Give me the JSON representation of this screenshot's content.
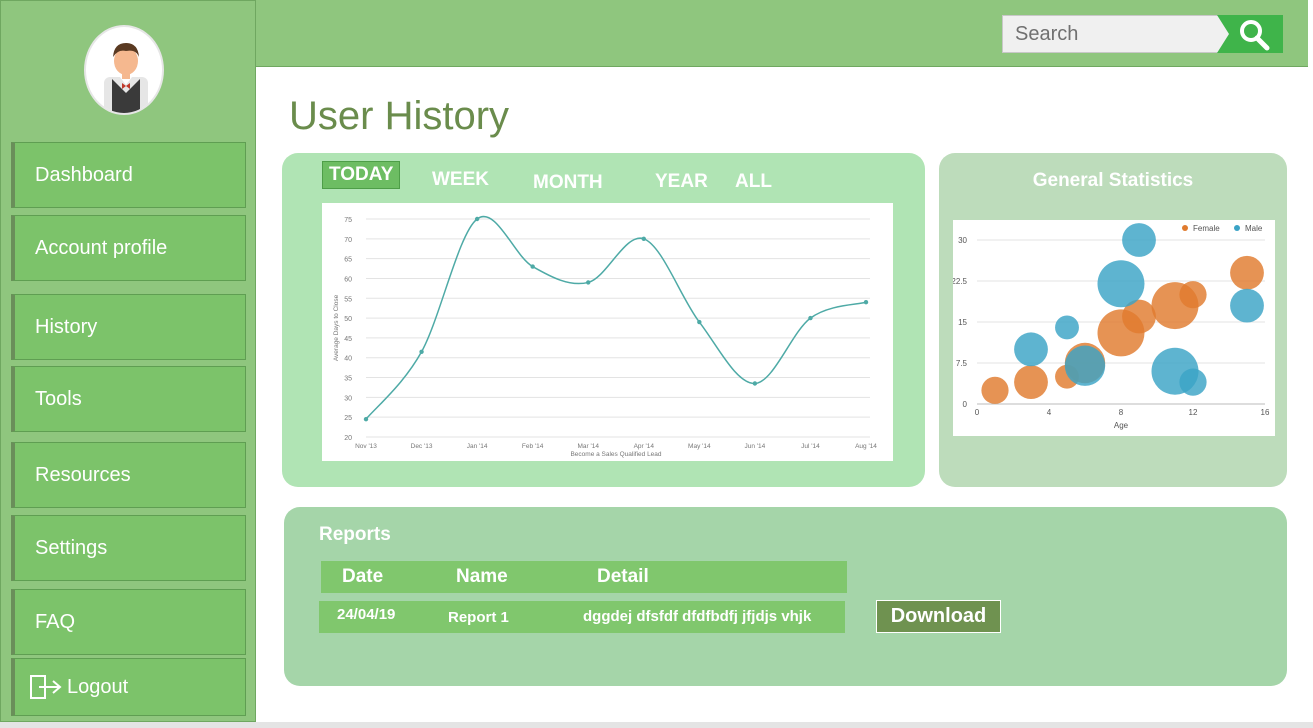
{
  "sidebar": {
    "items": [
      {
        "label": "Dashboard"
      },
      {
        "label": "Account profile"
      },
      {
        "label": "History"
      },
      {
        "label": "Tools"
      },
      {
        "label": "Resources"
      },
      {
        "label": "Settings"
      },
      {
        "label": "FAQ"
      },
      {
        "label": "Logout",
        "icon": "logout-icon"
      }
    ]
  },
  "search": {
    "placeholder": "Search",
    "icon": "search-icon"
  },
  "page_title": "User History",
  "tabs": [
    {
      "label": "TODAY",
      "active": true
    },
    {
      "label": "WEEK"
    },
    {
      "label": "MONTH"
    },
    {
      "label": "YEAR"
    },
    {
      "label": "ALL"
    }
  ],
  "stats_title": "General Statistics",
  "reports": {
    "title": "Reports",
    "columns": [
      "Date",
      "Name",
      "Detail"
    ],
    "rows": [
      {
        "date": "24/04/19",
        "name": "Report 1",
        "detail": "dggdej dfsfdf dfdfbdfj jfjdjs vhjk"
      }
    ],
    "download_label": "Download"
  },
  "colors": {
    "sidebar": "#8fc67e",
    "line": "#4eaaa6",
    "female": "#e07b2e",
    "male": "#3aa3c6",
    "title": "#6a8c4c"
  },
  "chart_data": [
    {
      "type": "line",
      "title": "",
      "xlabel": "Become a Sales Qualified Lead",
      "ylabel": "Average Days to Close",
      "x": [
        "Nov '13",
        "Dec '13",
        "Jan '14",
        "Feb '14",
        "Mar '14",
        "Apr '14",
        "May '14",
        "Jun '14",
        "Jul '14",
        "Aug '14"
      ],
      "values": [
        24.5,
        41.5,
        75,
        63,
        59,
        70,
        49,
        33.5,
        50,
        54
      ],
      "yticks": [
        20,
        25,
        30,
        35,
        40,
        45,
        50,
        55,
        60,
        65,
        70,
        75
      ],
      "ylim": [
        20,
        75
      ],
      "grid": true,
      "smooth": true
    },
    {
      "type": "scatter",
      "title": "",
      "xlabel": "Age",
      "ylabel": "",
      "xlim": [
        0,
        16
      ],
      "ylim": [
        0,
        30
      ],
      "xticks": [
        0,
        4,
        8,
        12,
        16
      ],
      "yticks": [
        0,
        7.5,
        15,
        22.5,
        30
      ],
      "legend_position": "top-right",
      "series": [
        {
          "name": "Female",
          "points": [
            {
              "x": 1,
              "y": 2.5,
              "size": 2
            },
            {
              "x": 3,
              "y": 4,
              "size": 3
            },
            {
              "x": 5,
              "y": 5,
              "size": 1.5
            },
            {
              "x": 6,
              "y": 7.5,
              "size": 4
            },
            {
              "x": 8,
              "y": 13,
              "size": 5
            },
            {
              "x": 9,
              "y": 16,
              "size": 3
            },
            {
              "x": 11,
              "y": 18,
              "size": 5
            },
            {
              "x": 12,
              "y": 20,
              "size": 2
            },
            {
              "x": 15,
              "y": 24,
              "size": 3
            }
          ]
        },
        {
          "name": "Male",
          "points": [
            {
              "x": 3,
              "y": 10,
              "size": 3
            },
            {
              "x": 5,
              "y": 14,
              "size": 1.5
            },
            {
              "x": 6,
              "y": 7,
              "size": 4
            },
            {
              "x": 8,
              "y": 22,
              "size": 5
            },
            {
              "x": 9,
              "y": 30,
              "size": 3
            },
            {
              "x": 11,
              "y": 6,
              "size": 5
            },
            {
              "x": 12,
              "y": 4,
              "size": 2
            },
            {
              "x": 15,
              "y": 18,
              "size": 3
            }
          ]
        }
      ]
    }
  ]
}
